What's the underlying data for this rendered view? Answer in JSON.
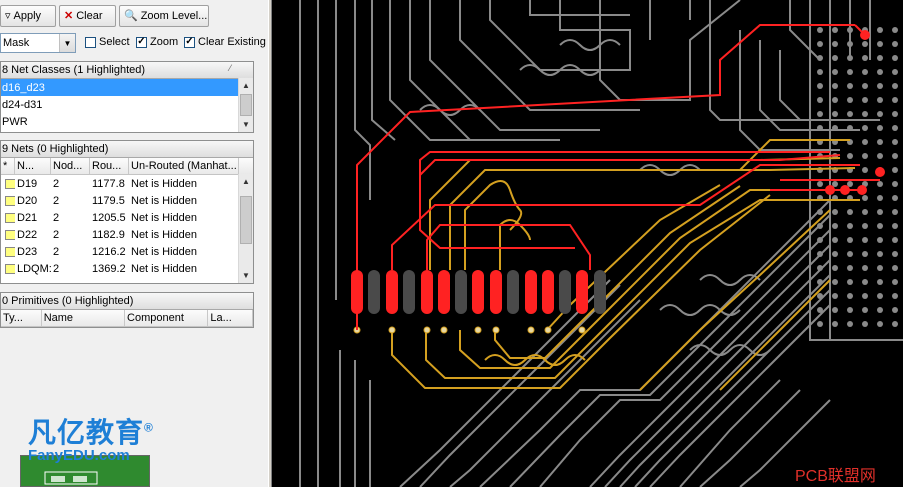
{
  "toolbar": {
    "apply_label": "Apply",
    "clear_label": "Clear",
    "zoom_level_label": "Zoom Level..."
  },
  "filter": {
    "mode_value": "Mask",
    "select_label": "Select",
    "select_checked": false,
    "zoom_label": "Zoom",
    "zoom_checked": true,
    "clear_existing_label": "Clear Existing",
    "clear_existing_checked": true
  },
  "net_classes": {
    "header": "8 Net Classes (1 Highlighted)",
    "items": [
      "d16_d23",
      "d24-d31",
      "PWR"
    ],
    "selected_index": 0
  },
  "nets": {
    "header": "9 Nets (0 Highlighted)",
    "columns": [
      "*",
      "N...",
      "Nod...",
      "Rou...",
      "Un-Routed (Manhat..."
    ],
    "rows": [
      {
        "name": "D19",
        "nodes": "2",
        "routed": "1177.8",
        "unrouted": "Net is Hidden"
      },
      {
        "name": "D20",
        "nodes": "2",
        "routed": "1179.5",
        "unrouted": "Net is Hidden"
      },
      {
        "name": "D21",
        "nodes": "2",
        "routed": "1205.5",
        "unrouted": "Net is Hidden"
      },
      {
        "name": "D22",
        "nodes": "2",
        "routed": "1182.9",
        "unrouted": "Net is Hidden"
      },
      {
        "name": "D23",
        "nodes": "2",
        "routed": "1216.2",
        "unrouted": "Net is Hidden"
      },
      {
        "name": "LDQM:",
        "nodes": "2",
        "routed": "1369.2",
        "unrouted": "Net is Hidden"
      }
    ]
  },
  "primitives": {
    "header": "0 Primitives (0 Highlighted)",
    "columns": [
      "Ty...",
      "Name",
      "Component",
      "La..."
    ]
  },
  "watermarks": {
    "brand": "凡亿教育",
    "brand_mark": "®",
    "brand_url": "FanyEDU.com",
    "site": "PCB联盟网"
  },
  "colors": {
    "highlight_net": "#ff2222",
    "trace_gold": "#d4a020",
    "trace_gray": "#8a8a8a",
    "pad_dim": "#4a4a4a",
    "selection": "#3399ff"
  }
}
